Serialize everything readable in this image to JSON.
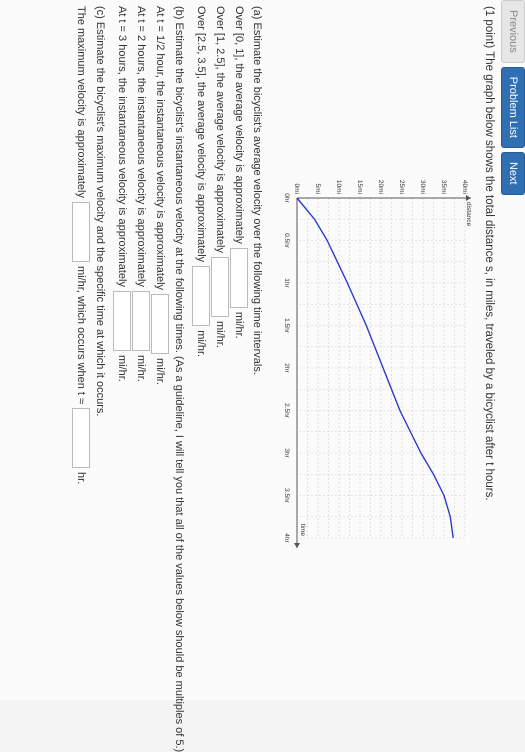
{
  "nav": {
    "previous": "Previous",
    "problem_list": "Problem List",
    "next": "Next"
  },
  "intro": {
    "points": "(1 point)",
    "text": "The graph below shows the total distance s, in miles, traveled by a bicyclist after t hours."
  },
  "chart_data": {
    "type": "line",
    "ylabel": "distance",
    "xlabel": "time",
    "x_ticks": [
      "0hr",
      "0.5hr",
      "1hr",
      "1.5hr",
      "2hr",
      "2.5hr",
      "3hr",
      "3.5hr",
      "4hr"
    ],
    "y_ticks": [
      "0mi",
      "5mi",
      "10mi",
      "15mi",
      "20mi",
      "25mi",
      "30mi",
      "35mi",
      "40mi"
    ],
    "xlim": [
      0,
      4
    ],
    "ylim": [
      0,
      40
    ],
    "series": [
      {
        "x": [
          0,
          0.25,
          0.5,
          1,
          1.5,
          2,
          2.5,
          3,
          3.25,
          3.5,
          3.75,
          4
        ],
        "y": [
          0,
          4.2,
          7.2,
          12,
          16.5,
          20.5,
          24.5,
          29.5,
          32.5,
          35,
          36.5,
          37.2
        ]
      }
    ]
  },
  "parts": {
    "a_head": "(a) Estimate the bicyclist's average velocity over the following time intervals.",
    "a1": "Over [0, 1], the average velocity is approximately",
    "a2": "Over [1, 2.5], the average velocity is approximately",
    "a3": "Over [2.5, 3.5], the average velocity is approximately",
    "b_head": "(b) Estimate the bicyclist's instantaneous velocity at the following times. (As a guideline, I will tell you that all of the values below should be multiples of 5.)",
    "b1": "At t = 1/2 hour, the instantaneous velocity is approximately",
    "b2": "At t = 2 hours, the instantaneous velocity is approximately",
    "b3": "At t = 3 hours, the instantaneous velocity is approximately",
    "c_head": "(c) Estimate the bicyclist's maximum velocity and the specific time at which it occurs.",
    "c1": "The maximum velocity is approximately",
    "c2": "mi/hr, which occurs when t ≈",
    "unit": "mi/hr.",
    "hr": "hr."
  }
}
